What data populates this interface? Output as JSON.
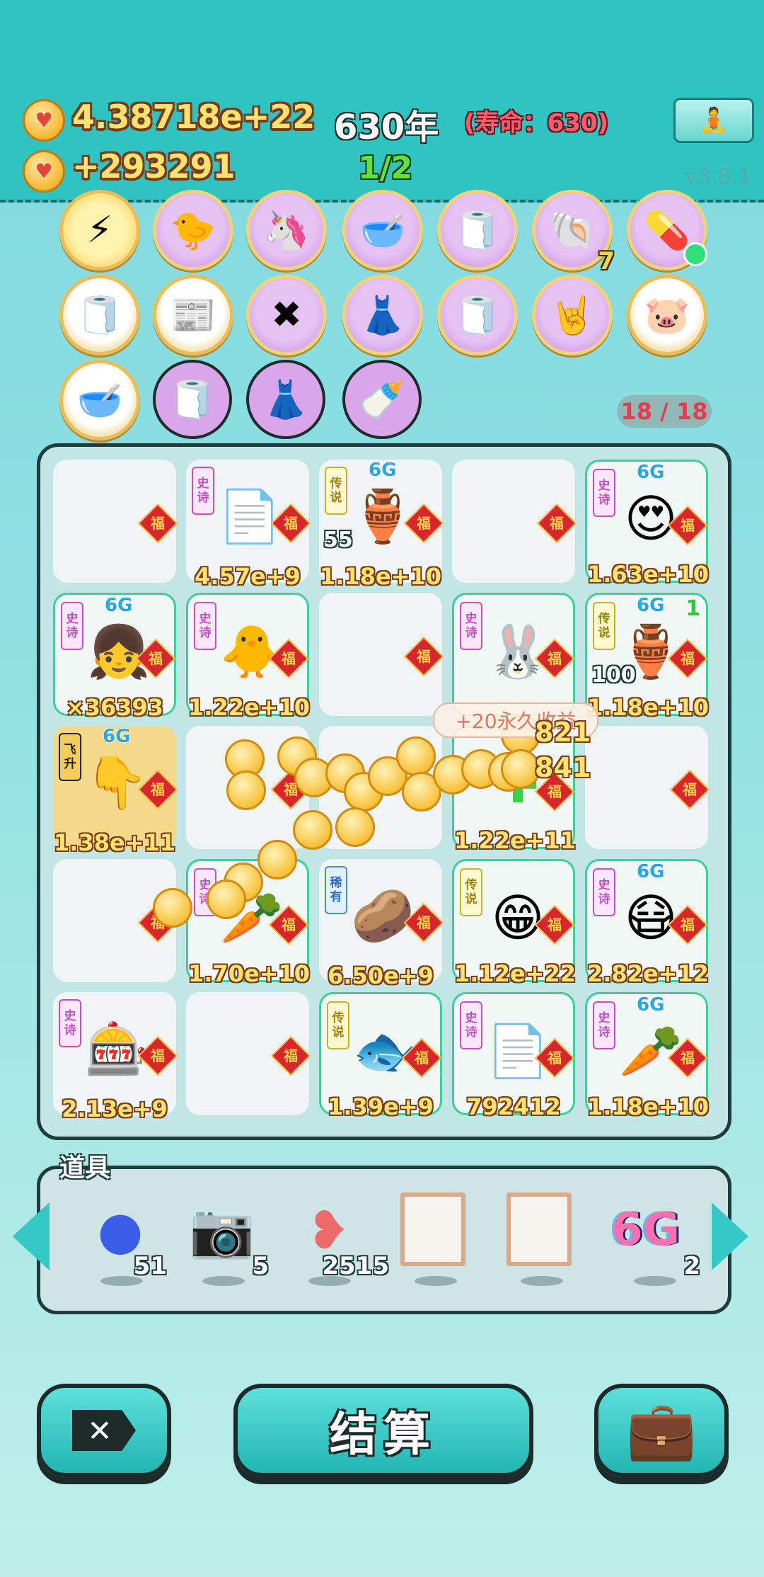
{
  "header": {
    "coins_total": "4.38718e+22",
    "coins_rate": "+293291",
    "age": "630年",
    "lifespan": "(寿命：630)",
    "progress": "1/2",
    "version": "v3.8.1"
  },
  "badge_counter": "18 / 18",
  "badges_row1_last_number": "7",
  "board": {
    "cells": [
      {
        "value": "",
        "tag": ""
      },
      {
        "value": "4.57e+9",
        "tag": "史诗"
      },
      {
        "value": "1.18e+10",
        "tag": "传说",
        "g6": "6G",
        "small": "55"
      },
      {
        "value": "",
        "tag": ""
      },
      {
        "value": "1.63e+10",
        "tag": "史诗",
        "g6": "6G"
      },
      {
        "value": "×36393",
        "tag": "史诗",
        "g6": "6G"
      },
      {
        "value": "1.22e+10",
        "tag": "史诗"
      },
      {
        "value": "",
        "tag": ""
      },
      {
        "value": "",
        "tag": "史诗"
      },
      {
        "value": "1.18e+10",
        "tag": "传说",
        "g6": "6G",
        "small": "100",
        "corner": "1"
      },
      {
        "value": "1.38e+11",
        "tag": "飞升",
        "g6": "6G"
      },
      {
        "value": "",
        "tag": ""
      },
      {
        "value": "",
        "tag": ""
      },
      {
        "value": "1.22e+11",
        "tag": ""
      },
      {
        "value": "",
        "tag": ""
      },
      {
        "value": "",
        "tag": ""
      },
      {
        "value": "1.70e+10",
        "tag": "史诗"
      },
      {
        "value": "6.50e+9",
        "tag": "稀有"
      },
      {
        "value": "1.12e+22",
        "tag": "传说"
      },
      {
        "value": "2.82e+12",
        "tag": "史诗",
        "g6": "6G"
      },
      {
        "value": "2.13e+9",
        "tag": "史诗"
      },
      {
        "value": "",
        "tag": ""
      },
      {
        "value": "1.39e+9",
        "tag": "传说"
      },
      {
        "value": "792412",
        "tag": "史诗"
      },
      {
        "value": "1.18e+10",
        "tag": "史诗",
        "g6": "6G"
      }
    ],
    "fu_label": "福",
    "toast": "+20永久收益",
    "float_1": "821",
    "float_2": "841"
  },
  "tools": {
    "title": "道具",
    "items": [
      {
        "icon": "blueberry-icon",
        "count": "51"
      },
      {
        "icon": "camera-icon",
        "count": "5"
      },
      {
        "icon": "liver-icon",
        "count": "2515"
      },
      {
        "icon": "empty-frame-icon",
        "count": ""
      },
      {
        "icon": "empty-frame-icon",
        "count": ""
      },
      {
        "icon": "6g-icon",
        "label": "6G",
        "count": "2"
      }
    ]
  },
  "buttons": {
    "settle": "结算",
    "close_symbol": "✕"
  }
}
